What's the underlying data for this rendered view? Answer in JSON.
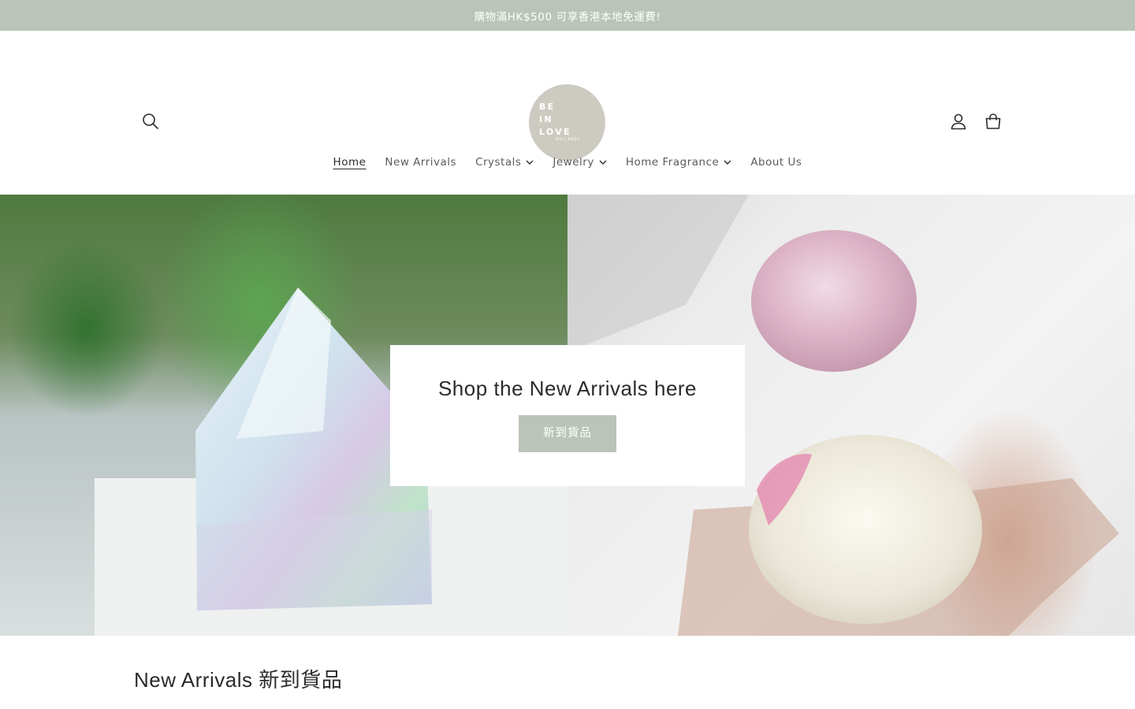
{
  "announcement": {
    "text": "購物滿HK$500 可享香港本地免運費!"
  },
  "header": {
    "logo": {
      "lines": [
        "BE",
        "IN",
        "LOVE"
      ],
      "subline": "WELLNESS"
    },
    "icons": {
      "search": "search-icon",
      "account": "account-icon",
      "cart": "cart-icon"
    }
  },
  "nav": {
    "items": [
      {
        "label": "Home",
        "active": true,
        "has_dropdown": false
      },
      {
        "label": "New Arrivals",
        "active": false,
        "has_dropdown": false
      },
      {
        "label": "Crystals",
        "active": false,
        "has_dropdown": true
      },
      {
        "label": "Jewelry",
        "active": false,
        "has_dropdown": true
      },
      {
        "label": "Home Fragrance",
        "active": false,
        "has_dropdown": true
      },
      {
        "label": "About Us",
        "active": false,
        "has_dropdown": false
      }
    ]
  },
  "hero": {
    "heading": "Shop the New Arrivals here",
    "button_label": "新到貨品"
  },
  "section": {
    "title": "New Arrivals 新到貨品"
  },
  "colors": {
    "accent": "#bac4b8",
    "logo_bg": "#cdcbc1",
    "text": "#2b2b2b"
  }
}
